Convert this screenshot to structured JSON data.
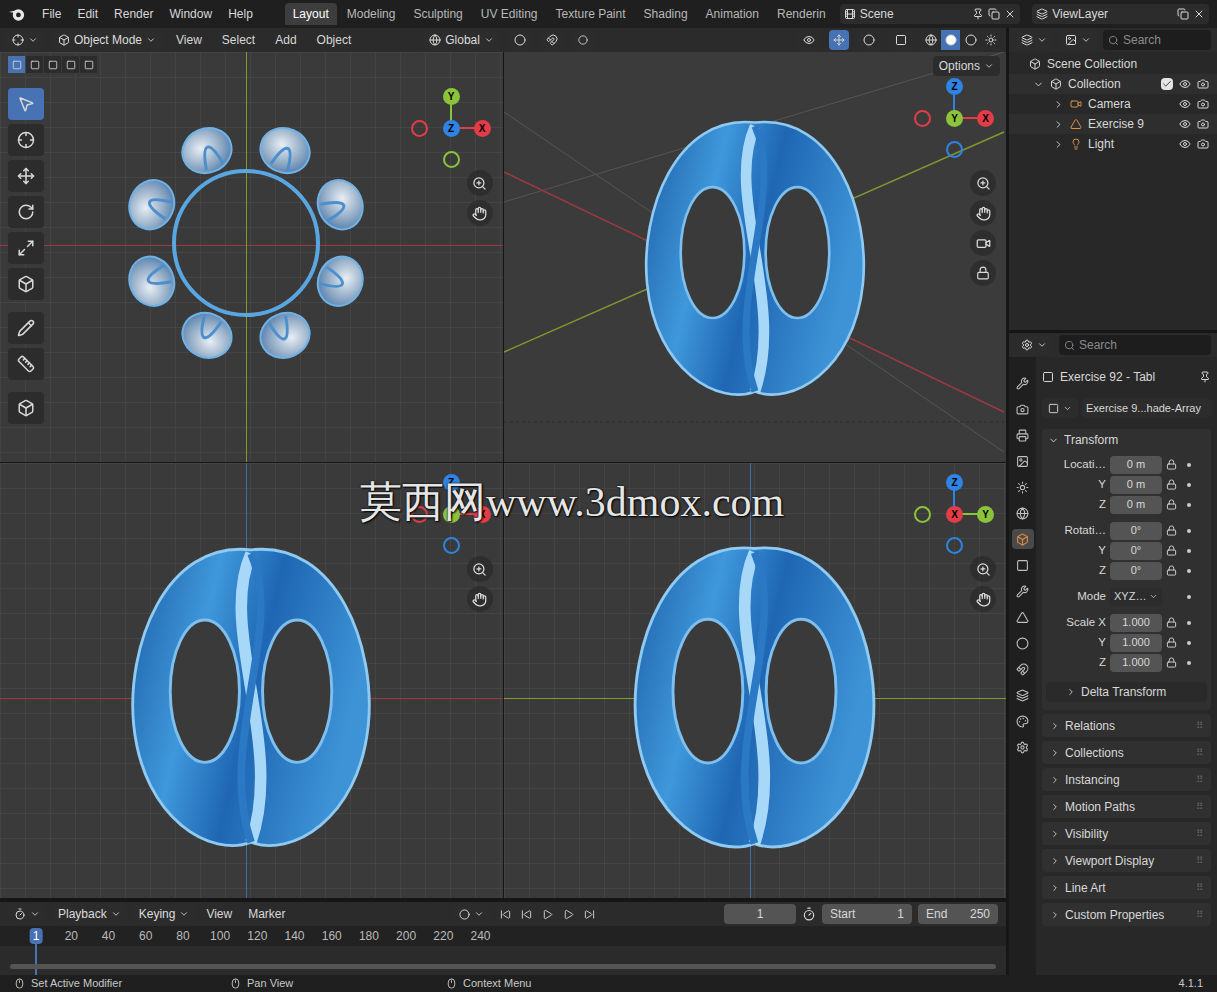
{
  "window": {
    "menu": [
      "File",
      "Edit",
      "Render",
      "Window",
      "Help"
    ],
    "version": "4.1.1"
  },
  "workspaces": [
    {
      "label": "Layout",
      "selected": true
    },
    {
      "label": "Modeling",
      "selected": false
    },
    {
      "label": "Sculpting",
      "selected": false
    },
    {
      "label": "UV Editing",
      "selected": false
    },
    {
      "label": "Texture Paint",
      "selected": false
    },
    {
      "label": "Shading",
      "selected": false
    },
    {
      "label": "Animation",
      "selected": false
    },
    {
      "label": "Renderin",
      "selected": false
    }
  ],
  "scene": "Scene",
  "view_layer": "ViewLayer",
  "viewport_header": {
    "mode": "Object Mode",
    "menus": [
      "View",
      "Select",
      "Add",
      "Object"
    ],
    "orientation": "Global",
    "options": "Options"
  },
  "viewports": [
    {
      "view": "top",
      "axes": [
        {
          "label": "Y",
          "color": "#8bc33a"
        },
        {
          "label": "Z",
          "color": "#2f83e3"
        },
        {
          "label": "X",
          "color": "#e23c47"
        }
      ]
    },
    {
      "view": "perspective",
      "axes": [
        {
          "label": "Z",
          "color": "#2f83e3"
        },
        {
          "label": "Y",
          "color": "#8bc33a"
        },
        {
          "label": "X",
          "color": "#e23c47"
        }
      ]
    },
    {
      "view": "front",
      "axes": [
        {
          "label": "Z",
          "color": "#2f83e3"
        },
        {
          "label": "Y",
          "color": "#8bc33a"
        },
        {
          "label": "X",
          "color": "#e23c47"
        }
      ]
    },
    {
      "view": "right",
      "axes": [
        {
          "label": "Z",
          "color": "#2f83e3"
        },
        {
          "label": "X",
          "color": "#e23c47"
        },
        {
          "label": "Y",
          "color": "#8bc33a"
        }
      ]
    }
  ],
  "watermark": "莫西网www.3dmox.com",
  "outliner": {
    "search": "Search",
    "root": "Scene Collection",
    "collection": {
      "label": "Collection",
      "checked": true,
      "expanded": true
    },
    "items": [
      {
        "label": "Camera",
        "kind": "camera"
      },
      {
        "label": "Exercise 9",
        "kind": "mesh"
      },
      {
        "label": "Light",
        "kind": "light"
      }
    ]
  },
  "properties": {
    "search": "Search",
    "object": "Exercise 92 - Tabl",
    "data": "Exercise 9...hade-Array",
    "transform": {
      "title": "Transform",
      "expanded": true,
      "rows": [
        {
          "label": "Locati…",
          "value": "0 m",
          "kind": "field"
        },
        {
          "label": "Y",
          "value": "0 m",
          "kind": "field"
        },
        {
          "label": "Z",
          "value": "0 m",
          "kind": "field"
        },
        {
          "label": "Rotati…",
          "value": "0°",
          "kind": "field"
        },
        {
          "label": "Y",
          "value": "0°",
          "kind": "field"
        },
        {
          "label": "Z",
          "value": "0°",
          "kind": "field"
        },
        {
          "label": "Mode",
          "value": "XYZ…",
          "kind": "dropdown"
        },
        {
          "label": "Scale X",
          "value": "1.000",
          "kind": "field"
        },
        {
          "label": "Y",
          "value": "1.000",
          "kind": "field"
        },
        {
          "label": "Z",
          "value": "1.000",
          "kind": "field"
        }
      ],
      "subpanel": {
        "label": "Delta Transform",
        "expanded": false
      }
    },
    "panels": [
      {
        "label": "Relations",
        "expanded": false
      },
      {
        "label": "Collections",
        "expanded": false
      },
      {
        "label": "Instancing",
        "expanded": false
      },
      {
        "label": "Motion Paths",
        "expanded": false
      },
      {
        "label": "Visibility",
        "expanded": false
      },
      {
        "label": "Viewport Display",
        "expanded": false
      },
      {
        "label": "Line Art",
        "expanded": false
      },
      {
        "label": "Custom Properties",
        "expanded": false
      }
    ]
  },
  "timeline": {
    "menus": [
      "Playback",
      "Keying",
      "View",
      "Marker"
    ],
    "current_frame": "1",
    "start_label": "Start",
    "start": "1",
    "end_label": "End",
    "end": "250",
    "ticks": [
      {
        "label": "1",
        "selected": true
      },
      {
        "label": "20",
        "selected": false
      },
      {
        "label": "40",
        "selected": false
      },
      {
        "label": "60",
        "selected": false
      },
      {
        "label": "80",
        "selected": false
      },
      {
        "label": "100",
        "selected": false
      },
      {
        "label": "120",
        "selected": false
      },
      {
        "label": "140",
        "selected": false
      },
      {
        "label": "160",
        "selected": false
      },
      {
        "label": "180",
        "selected": false
      },
      {
        "label": "200",
        "selected": false
      },
      {
        "label": "220",
        "selected": false
      },
      {
        "label": "240",
        "selected": false
      }
    ]
  },
  "status_bar": [
    "Set Active Modifier",
    "Pan View",
    "Context Menu"
  ]
}
